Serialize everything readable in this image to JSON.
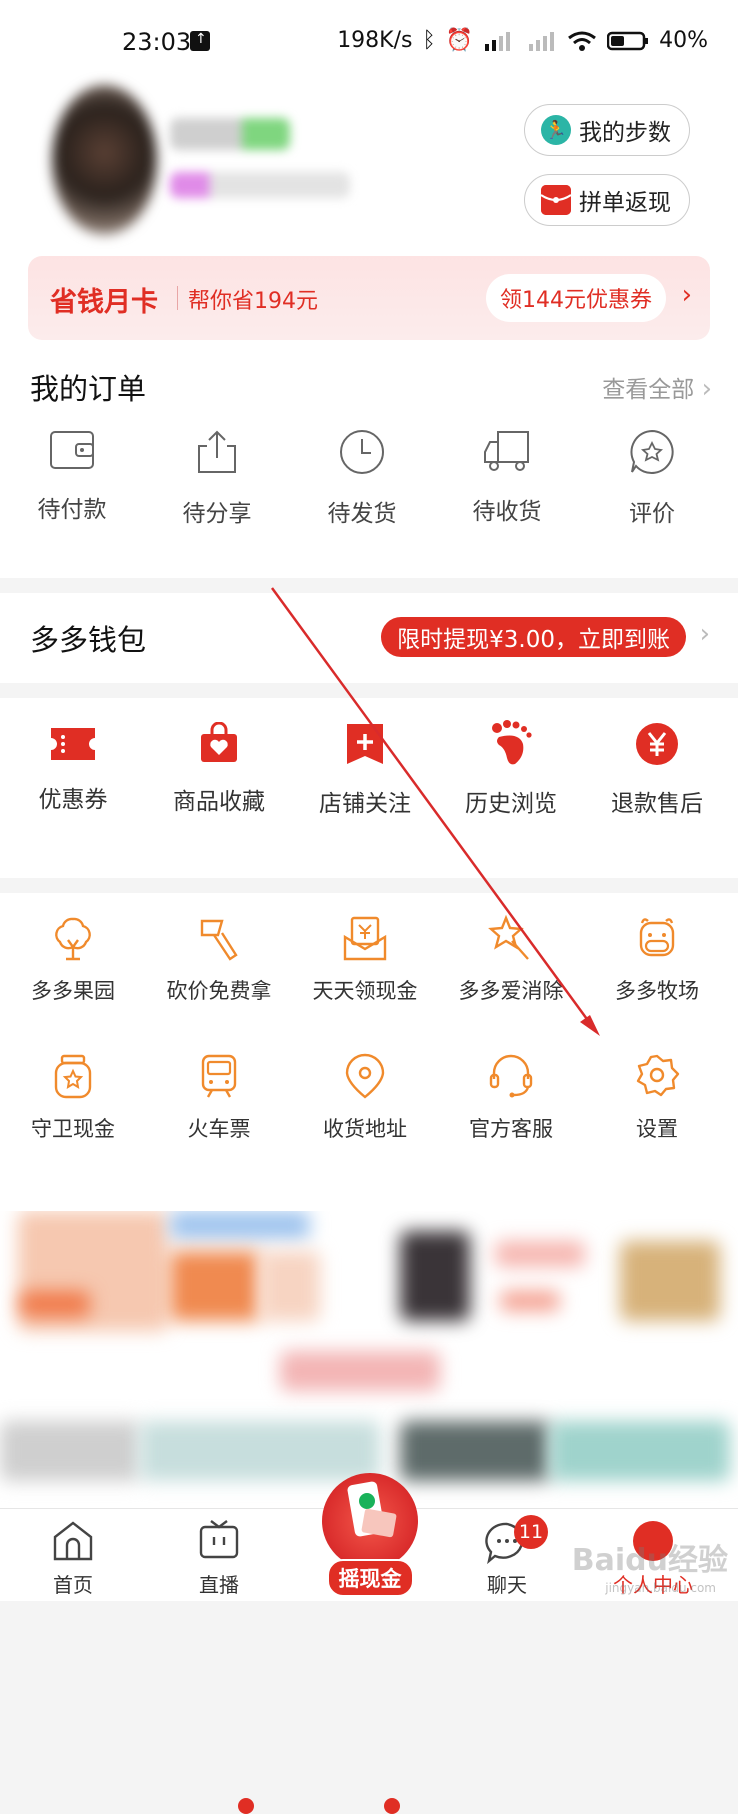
{
  "status_bar": {
    "time": "23:03",
    "speed": "198K/s",
    "battery": "40%"
  },
  "profile": {
    "steps_label": "我的步数",
    "cashback_label": "拼单返现"
  },
  "money_card": {
    "title": "省钱月卡",
    "subtitle": "帮你省194元",
    "coupon": "领144元优惠券"
  },
  "orders": {
    "title": "我的订单",
    "view_all": "查看全部",
    "items": [
      {
        "label": "待付款",
        "icon": "wallet-icon"
      },
      {
        "label": "待分享",
        "icon": "share-icon"
      },
      {
        "label": "待发货",
        "icon": "clock-icon"
      },
      {
        "label": "待收货",
        "icon": "truck-icon"
      },
      {
        "label": "评价",
        "icon": "star-bubble-icon"
      }
    ]
  },
  "wallet": {
    "title": "多多钱包",
    "badge": "限时提现¥3.00，立即到账"
  },
  "quick_items": [
    {
      "label": "优惠券",
      "icon": "coupon-icon"
    },
    {
      "label": "商品收藏",
      "icon": "bag-heart-icon"
    },
    {
      "label": "店铺关注",
      "icon": "store-plus-icon"
    },
    {
      "label": "历史浏览",
      "icon": "footprint-icon"
    },
    {
      "label": "退款售后",
      "icon": "yen-circle-icon"
    }
  ],
  "services": [
    {
      "label": "多多果园",
      "icon": "tree-icon",
      "dot": false
    },
    {
      "label": "砍价免费拿",
      "icon": "axe-icon",
      "dot": true
    },
    {
      "label": "天天领现金",
      "icon": "cash-envelope-icon",
      "dot": true
    },
    {
      "label": "多多爱消除",
      "icon": "star-wand-icon",
      "dot": false
    },
    {
      "label": "多多牧场",
      "icon": "cow-icon",
      "dot": false
    },
    {
      "label": "守卫现金",
      "icon": "money-jar-icon",
      "dot": false
    },
    {
      "label": "火车票",
      "icon": "train-icon",
      "dot": false
    },
    {
      "label": "收货地址",
      "icon": "location-pin-icon",
      "dot": false
    },
    {
      "label": "官方客服",
      "icon": "headset-icon",
      "dot": false
    },
    {
      "label": "设置",
      "icon": "settings-gear-icon",
      "dot": false
    }
  ],
  "tabbar": {
    "home": "首页",
    "live": "直播",
    "shake": "摇现金",
    "chat": "聊天",
    "chat_badge": "11",
    "me": "个人中心"
  },
  "watermark": {
    "text": "Baidu经验",
    "sub": "jingyan.baidu.com"
  },
  "colors": {
    "brand_red": "#e02e24",
    "service_orange": "#f08a2c"
  }
}
